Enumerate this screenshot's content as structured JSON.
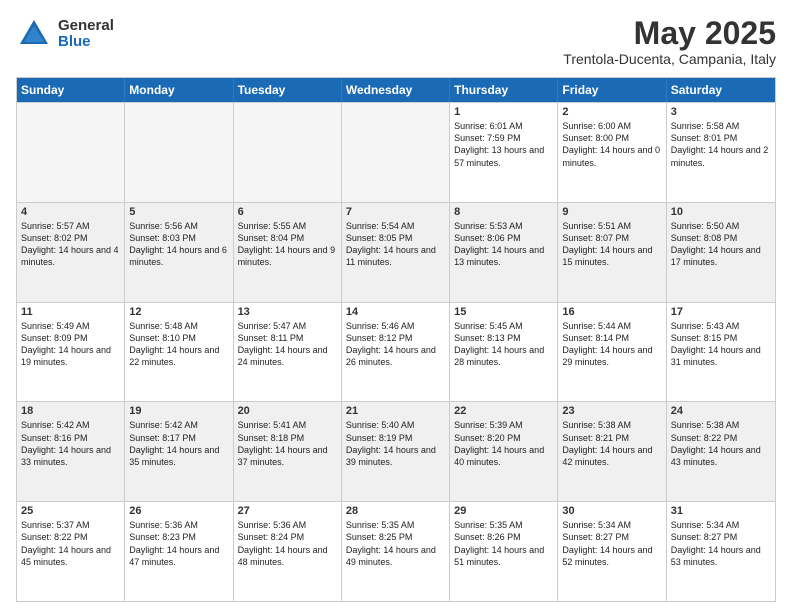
{
  "logo": {
    "general": "General",
    "blue": "Blue"
  },
  "title": "May 2025",
  "location": "Trentola-Ducenta, Campania, Italy",
  "header_days": [
    "Sunday",
    "Monday",
    "Tuesday",
    "Wednesday",
    "Thursday",
    "Friday",
    "Saturday"
  ],
  "rows": [
    [
      {
        "day": "",
        "text": "",
        "empty": true
      },
      {
        "day": "",
        "text": "",
        "empty": true
      },
      {
        "day": "",
        "text": "",
        "empty": true
      },
      {
        "day": "",
        "text": "",
        "empty": true
      },
      {
        "day": "1",
        "text": "Sunrise: 6:01 AM\nSunset: 7:59 PM\nDaylight: 13 hours and 57 minutes.",
        "empty": false
      },
      {
        "day": "2",
        "text": "Sunrise: 6:00 AM\nSunset: 8:00 PM\nDaylight: 14 hours and 0 minutes.",
        "empty": false
      },
      {
        "day": "3",
        "text": "Sunrise: 5:58 AM\nSunset: 8:01 PM\nDaylight: 14 hours and 2 minutes.",
        "empty": false
      }
    ],
    [
      {
        "day": "4",
        "text": "Sunrise: 5:57 AM\nSunset: 8:02 PM\nDaylight: 14 hours and 4 minutes.",
        "empty": false
      },
      {
        "day": "5",
        "text": "Sunrise: 5:56 AM\nSunset: 8:03 PM\nDaylight: 14 hours and 6 minutes.",
        "empty": false
      },
      {
        "day": "6",
        "text": "Sunrise: 5:55 AM\nSunset: 8:04 PM\nDaylight: 14 hours and 9 minutes.",
        "empty": false
      },
      {
        "day": "7",
        "text": "Sunrise: 5:54 AM\nSunset: 8:05 PM\nDaylight: 14 hours and 11 minutes.",
        "empty": false
      },
      {
        "day": "8",
        "text": "Sunrise: 5:53 AM\nSunset: 8:06 PM\nDaylight: 14 hours and 13 minutes.",
        "empty": false
      },
      {
        "day": "9",
        "text": "Sunrise: 5:51 AM\nSunset: 8:07 PM\nDaylight: 14 hours and 15 minutes.",
        "empty": false
      },
      {
        "day": "10",
        "text": "Sunrise: 5:50 AM\nSunset: 8:08 PM\nDaylight: 14 hours and 17 minutes.",
        "empty": false
      }
    ],
    [
      {
        "day": "11",
        "text": "Sunrise: 5:49 AM\nSunset: 8:09 PM\nDaylight: 14 hours and 19 minutes.",
        "empty": false
      },
      {
        "day": "12",
        "text": "Sunrise: 5:48 AM\nSunset: 8:10 PM\nDaylight: 14 hours and 22 minutes.",
        "empty": false
      },
      {
        "day": "13",
        "text": "Sunrise: 5:47 AM\nSunset: 8:11 PM\nDaylight: 14 hours and 24 minutes.",
        "empty": false
      },
      {
        "day": "14",
        "text": "Sunrise: 5:46 AM\nSunset: 8:12 PM\nDaylight: 14 hours and 26 minutes.",
        "empty": false
      },
      {
        "day": "15",
        "text": "Sunrise: 5:45 AM\nSunset: 8:13 PM\nDaylight: 14 hours and 28 minutes.",
        "empty": false
      },
      {
        "day": "16",
        "text": "Sunrise: 5:44 AM\nSunset: 8:14 PM\nDaylight: 14 hours and 29 minutes.",
        "empty": false
      },
      {
        "day": "17",
        "text": "Sunrise: 5:43 AM\nSunset: 8:15 PM\nDaylight: 14 hours and 31 minutes.",
        "empty": false
      }
    ],
    [
      {
        "day": "18",
        "text": "Sunrise: 5:42 AM\nSunset: 8:16 PM\nDaylight: 14 hours and 33 minutes.",
        "empty": false
      },
      {
        "day": "19",
        "text": "Sunrise: 5:42 AM\nSunset: 8:17 PM\nDaylight: 14 hours and 35 minutes.",
        "empty": false
      },
      {
        "day": "20",
        "text": "Sunrise: 5:41 AM\nSunset: 8:18 PM\nDaylight: 14 hours and 37 minutes.",
        "empty": false
      },
      {
        "day": "21",
        "text": "Sunrise: 5:40 AM\nSunset: 8:19 PM\nDaylight: 14 hours and 39 minutes.",
        "empty": false
      },
      {
        "day": "22",
        "text": "Sunrise: 5:39 AM\nSunset: 8:20 PM\nDaylight: 14 hours and 40 minutes.",
        "empty": false
      },
      {
        "day": "23",
        "text": "Sunrise: 5:38 AM\nSunset: 8:21 PM\nDaylight: 14 hours and 42 minutes.",
        "empty": false
      },
      {
        "day": "24",
        "text": "Sunrise: 5:38 AM\nSunset: 8:22 PM\nDaylight: 14 hours and 43 minutes.",
        "empty": false
      }
    ],
    [
      {
        "day": "25",
        "text": "Sunrise: 5:37 AM\nSunset: 8:22 PM\nDaylight: 14 hours and 45 minutes.",
        "empty": false
      },
      {
        "day": "26",
        "text": "Sunrise: 5:36 AM\nSunset: 8:23 PM\nDaylight: 14 hours and 47 minutes.",
        "empty": false
      },
      {
        "day": "27",
        "text": "Sunrise: 5:36 AM\nSunset: 8:24 PM\nDaylight: 14 hours and 48 minutes.",
        "empty": false
      },
      {
        "day": "28",
        "text": "Sunrise: 5:35 AM\nSunset: 8:25 PM\nDaylight: 14 hours and 49 minutes.",
        "empty": false
      },
      {
        "day": "29",
        "text": "Sunrise: 5:35 AM\nSunset: 8:26 PM\nDaylight: 14 hours and 51 minutes.",
        "empty": false
      },
      {
        "day": "30",
        "text": "Sunrise: 5:34 AM\nSunset: 8:27 PM\nDaylight: 14 hours and 52 minutes.",
        "empty": false
      },
      {
        "day": "31",
        "text": "Sunrise: 5:34 AM\nSunset: 8:27 PM\nDaylight: 14 hours and 53 minutes.",
        "empty": false
      }
    ]
  ]
}
